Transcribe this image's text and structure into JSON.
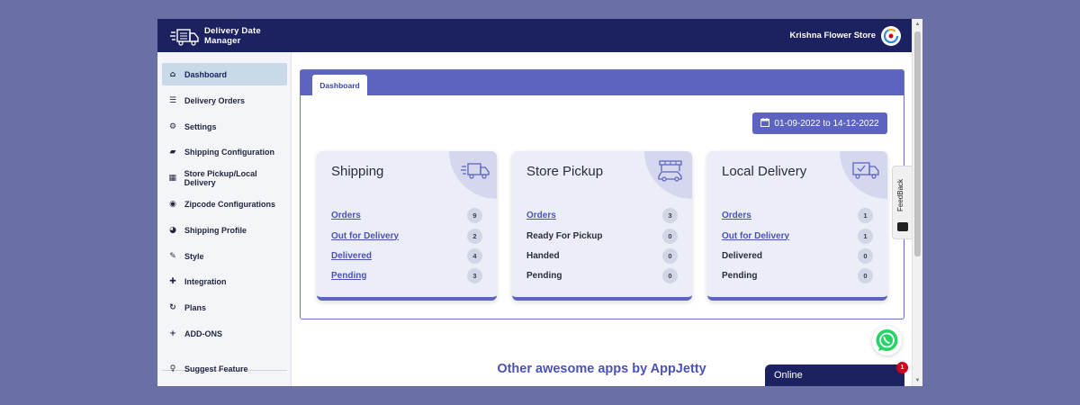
{
  "header": {
    "app_name": "Delivery Date Manager",
    "store_name": "Krishna Flower Store"
  },
  "sidebar": {
    "items": [
      {
        "label": "Dashboard",
        "icon": "home-icon",
        "active": true
      },
      {
        "label": "Delivery Orders",
        "icon": "list-icon"
      },
      {
        "label": "Settings",
        "icon": "gear-icon"
      },
      {
        "label": "Shipping Configuration",
        "icon": "truck-icon"
      },
      {
        "label": "Store Pickup/Local Delivery",
        "icon": "boxes-icon"
      },
      {
        "label": "Zipcode Configurations",
        "icon": "map-pin-icon"
      },
      {
        "label": "Shipping Profile",
        "icon": "shipping-profile-icon"
      },
      {
        "label": "Style",
        "icon": "brush-icon"
      },
      {
        "label": "Integration",
        "icon": "puzzle-icon"
      },
      {
        "label": "Plans",
        "icon": "refresh-icon"
      },
      {
        "label": "ADD-ONS",
        "icon": "plus-icon"
      }
    ],
    "footer_item": {
      "label": "Suggest Feature",
      "icon": "lightbulb-icon"
    }
  },
  "dashboard": {
    "tab_label": "Dashboard",
    "date_range": "01-09-2022 to 14-12-2022",
    "cards": [
      {
        "title": "Shipping",
        "icon": "delivery-truck-icon",
        "rows": [
          {
            "label": "Orders",
            "count": "9",
            "link": true
          },
          {
            "label": "Out for Delivery",
            "count": "2",
            "link": true
          },
          {
            "label": "Delivered",
            "count": "4",
            "link": true
          },
          {
            "label": "Pending",
            "count": "3",
            "link": true
          }
        ]
      },
      {
        "title": "Store Pickup",
        "icon": "store-car-icon",
        "rows": [
          {
            "label": "Orders",
            "count": "3",
            "link": true
          },
          {
            "label": "Ready For Pickup",
            "count": "0",
            "link": false
          },
          {
            "label": "Handed",
            "count": "0",
            "link": false
          },
          {
            "label": "Pending",
            "count": "0",
            "link": false
          }
        ]
      },
      {
        "title": "Local Delivery",
        "icon": "local-delivery-truck-icon",
        "rows": [
          {
            "label": "Orders",
            "count": "1",
            "link": true
          },
          {
            "label": "Out for Delivery",
            "count": "1",
            "link": true
          },
          {
            "label": "Delivered",
            "count": "0",
            "link": false
          },
          {
            "label": "Pending",
            "count": "0",
            "link": false
          }
        ]
      }
    ]
  },
  "feedback_label": "FeedBack",
  "apps_heading": "Other awesome apps by AppJetty",
  "chat": {
    "status": "Online",
    "badge": "1"
  },
  "colors": {
    "navy": "#1c2260",
    "accent": "#5c64c0",
    "active_nav": "#c8d9e8",
    "link": "#4a53b4",
    "badge_red": "#d0021b",
    "whatsapp_green": "#25d366"
  }
}
